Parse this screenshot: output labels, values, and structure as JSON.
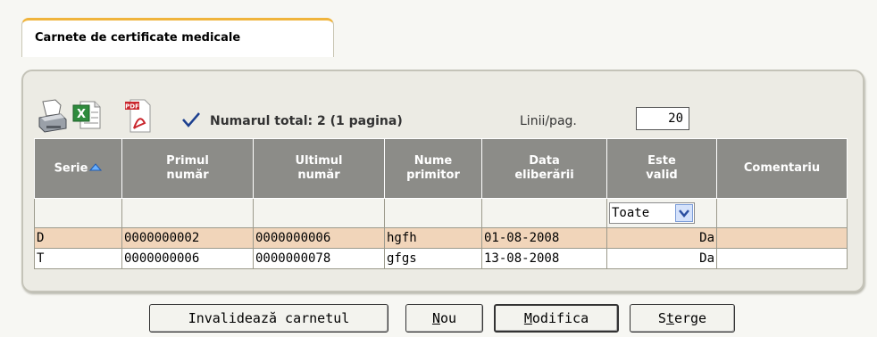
{
  "tab": {
    "label": "Carnete de certificate medicale"
  },
  "toolbar": {
    "icons": [
      "printer-icon",
      "excel-export-icon",
      "pdf-export-icon",
      "checkmark-icon"
    ],
    "total_label": "Numarul total: 2 (1 pagina)",
    "lines_label": "Linii/pag.",
    "lines_value": "20"
  },
  "table": {
    "columns": [
      {
        "label": "Serie"
      },
      {
        "label_line1": "Primul",
        "label_line2": "număr"
      },
      {
        "label_line1": "Ultimul",
        "label_line2": "număr"
      },
      {
        "label_line1": "Nume",
        "label_line2": "primitor"
      },
      {
        "label_line1": "Data",
        "label_line2": "eliberării"
      },
      {
        "label_line1": "Este",
        "label_line2": "valid"
      },
      {
        "label": "Comentariu"
      }
    ],
    "filter": {
      "valid_select": "Toate"
    },
    "rows": [
      {
        "serie": "D",
        "primul": "0000000002",
        "ultimul": "0000000006",
        "nume": "hgfh",
        "data": "01-08-2008",
        "valid": "Da",
        "comentariu": ""
      },
      {
        "serie": "T",
        "primul": "0000000006",
        "ultimul": "0000000078",
        "nume": "gfgs",
        "data": "13-08-2008",
        "valid": "Da",
        "comentariu": ""
      }
    ]
  },
  "buttons": {
    "invalidate": "Invalidează carnetul",
    "nou_first": "N",
    "nou_rest": "ou",
    "modifica_first": "M",
    "modifica_rest": "odifica",
    "sterge_first": "S",
    "sterge_mid": "t",
    "sterge_rest": "erge"
  },
  "colors": {
    "tab_accent": "#f0b43c",
    "header_bg": "#8c8c88",
    "selected_row": "#f1d5ba",
    "panel_bg": "#ecebe4"
  }
}
